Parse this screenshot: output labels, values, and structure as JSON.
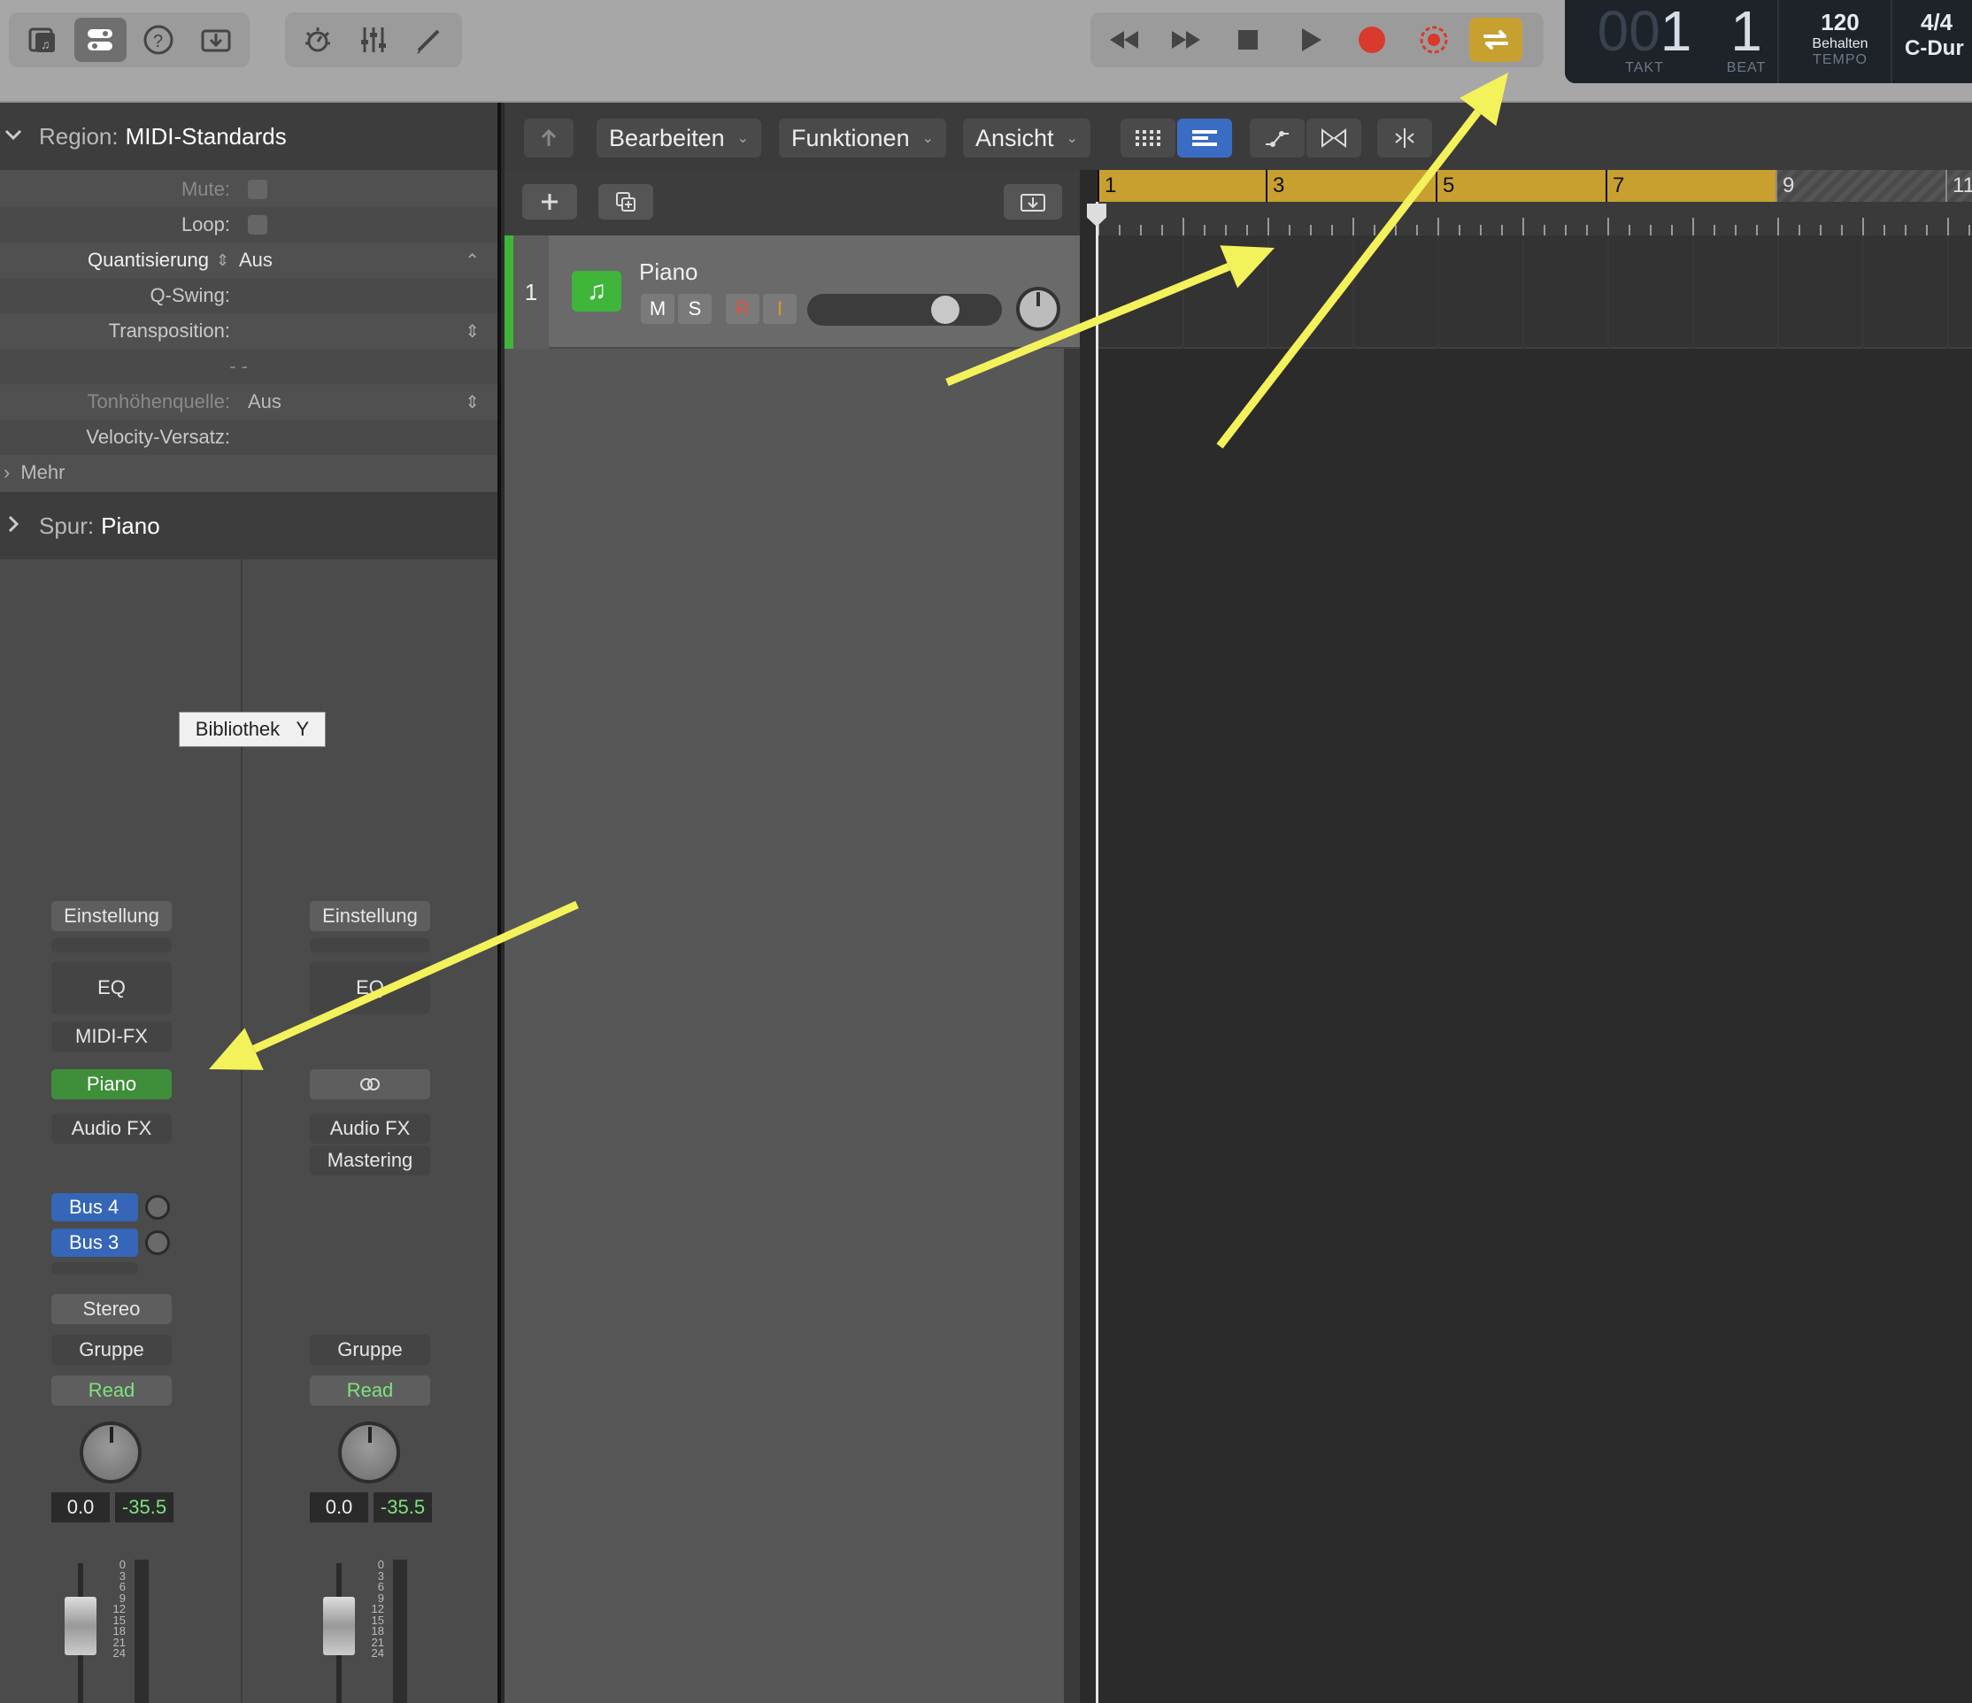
{
  "toolbar": {
    "left_icons": [
      "library-icon",
      "inspector-icon",
      "help-icon",
      "download-icon"
    ],
    "mid_icons": [
      "smart-controls-icon",
      "mixer-icon",
      "editors-icon"
    ],
    "transport_icons": [
      "rewind-icon",
      "forward-icon",
      "stop-icon",
      "play-icon",
      "record-icon",
      "capture-record-icon",
      "cycle-icon"
    ],
    "accent_color": "#c8a030"
  },
  "lcd": {
    "takt_dim": "00",
    "takt": "1",
    "takt_label": "TAKT",
    "beat": "1",
    "beat_label": "BEAT",
    "tempo": "120",
    "tempo_mode": "Behalten",
    "tempo_label": "TEMPO",
    "signature": "4/4",
    "key": "C-Dur"
  },
  "inspector": {
    "region_label": "Region:",
    "region_name": "MIDI-Standards",
    "mute_label": "Mute:",
    "loop_label": "Loop:",
    "quant_label": "Quantisierung",
    "quant_value": "Aus",
    "qswing_label": "Q-Swing:",
    "transpose_label": "Transposition:",
    "dashes": "- -",
    "pitch_label": "Tonhöhenquelle:",
    "pitch_value": "Aus",
    "velocity_label": "Velocity-Versatz:",
    "more_label": "Mehr",
    "track_label": "Spur:",
    "track_name": "Piano"
  },
  "tooltip": {
    "text": "Bibliothek",
    "key": "Y"
  },
  "strip_left": {
    "setting": "Einstellung",
    "eq": "EQ",
    "midifx": "MIDI-FX",
    "instrument": "Piano",
    "audiofx": "Audio FX",
    "bus4": "Bus 4",
    "bus3": "Bus 3",
    "output": "Stereo",
    "group": "Gruppe",
    "automation": "Read",
    "volume": "0.0",
    "peak": "-35.5"
  },
  "strip_right": {
    "setting": "Einstellung",
    "eq": "EQ",
    "audiofx": "Audio FX",
    "mastering": "Mastering",
    "group": "Gruppe",
    "automation": "Read",
    "volume": "0.0",
    "peak": "-35.5"
  },
  "meter_scale": [
    "0",
    "3",
    "6",
    "9",
    "12",
    "15",
    "18",
    "21",
    "24"
  ],
  "menus": {
    "edit": "Bearbeiten",
    "functions": "Funktionen",
    "view": "Ansicht"
  },
  "track": {
    "number": "1",
    "name": "Piano",
    "mute": "M",
    "solo": "S",
    "record": "R",
    "input": "I",
    "color": "#3fb63a"
  },
  "ruler": {
    "bars": [
      "1",
      "3",
      "5",
      "7",
      "9",
      "11"
    ],
    "cycle_color": "#c8a030"
  },
  "annotation": {
    "arrow_color": "#f4f25a"
  }
}
